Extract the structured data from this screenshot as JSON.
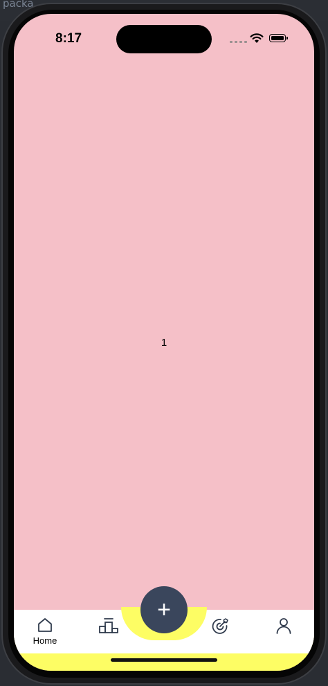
{
  "background_app": {
    "label": "packa"
  },
  "status_bar": {
    "time": "8:17"
  },
  "main": {
    "content_text": "1"
  },
  "tabbar": {
    "home_label": "Home",
    "fab_symbol": "+",
    "icons": [
      "home-icon",
      "leaderboard-icon",
      "add-icon",
      "target-icon",
      "profile-icon"
    ]
  },
  "colors": {
    "screen_background": "#f5c0c8",
    "tabbar_background": "#ffffff",
    "tabbar_accent": "#fdfd64",
    "fab_background": "#3a465c",
    "icon_color": "#2f3a4c"
  }
}
